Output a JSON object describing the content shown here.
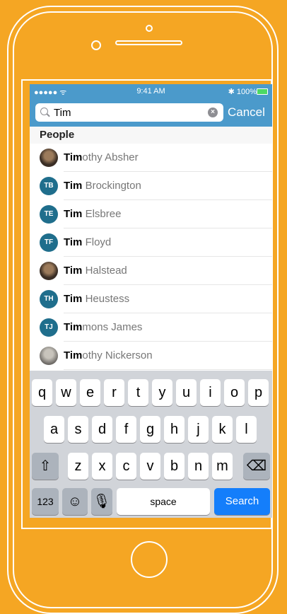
{
  "status_bar": {
    "carrier": "●●●●● ᯤ",
    "time": "9:41 AM",
    "battery": "✱ 100%"
  },
  "search": {
    "value": "Tim",
    "cancel_label": "Cancel"
  },
  "section": {
    "title": "People"
  },
  "people": [
    {
      "bold": "Tim",
      "rest": "othy Absher",
      "avatar": "photo"
    },
    {
      "bold": "Tim",
      "rest": " Brockington",
      "initials": "TB"
    },
    {
      "bold": "Tim",
      "rest": " Elsbree",
      "initials": "TE"
    },
    {
      "bold": "Tim",
      "rest": " Floyd",
      "initials": "TF"
    },
    {
      "bold": "Tim",
      "rest": " Halstead",
      "avatar": "photo"
    },
    {
      "bold": "Tim",
      "rest": " Heustess",
      "initials": "TH"
    },
    {
      "bold": "Tim",
      "rest": "mons James",
      "initials": "TJ"
    },
    {
      "bold": "Tim",
      "rest": "othy Nickerson",
      "avatar": "photo-light"
    }
  ],
  "keyboard": {
    "row1": [
      "q",
      "w",
      "e",
      "r",
      "t",
      "y",
      "u",
      "i",
      "o",
      "p"
    ],
    "row2": [
      "a",
      "s",
      "d",
      "f",
      "g",
      "h",
      "j",
      "k",
      "l"
    ],
    "row3": [
      "z",
      "x",
      "c",
      "v",
      "b",
      "n",
      "m"
    ],
    "shift": "⇧",
    "backspace": "⌫",
    "numbers": "123",
    "emoji": "☺",
    "mic": "🎙",
    "space": "space",
    "search": "Search"
  },
  "colors": {
    "background": "#F5A623",
    "header": "#4B9ACB",
    "avatar": "#1F6E8C",
    "search_key": "#147EFB"
  }
}
